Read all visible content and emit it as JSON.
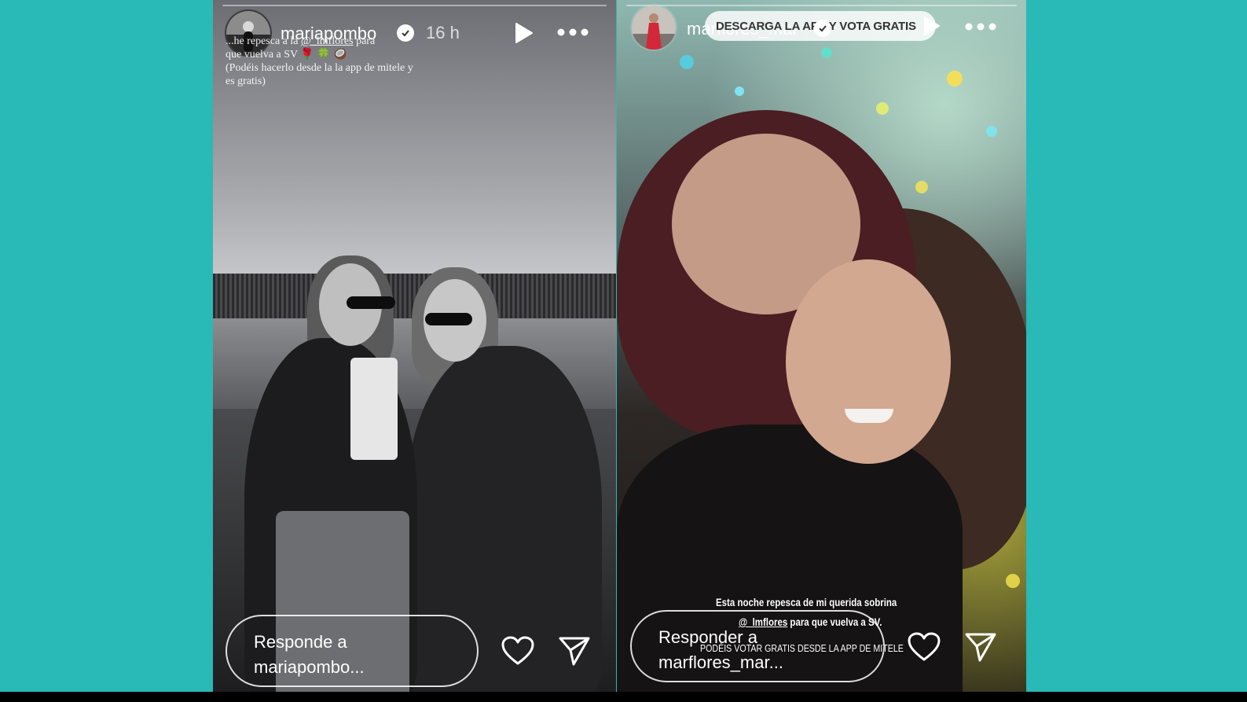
{
  "stories": {
    "left": {
      "username": "mariapombo",
      "timestamp": "16 h",
      "caption": {
        "line1_prefix": "...he repesca a la",
        "mention": "@_lmflores",
        "line1_suffix": "para",
        "line2": "que vuelva a SV 🌹 🍀 🥥",
        "line3": "(Podéis hacerlo desde la la app de mitele y",
        "line4": "es gratis)"
      },
      "reply_placeholder": {
        "line1": "Responde a",
        "line2": "mariapombo..."
      }
    },
    "right": {
      "username": "marflores_mar",
      "banner_text": "DESCARGA LA APP Y VOTA GRATIS",
      "caption": {
        "line1": "Esta noche repesca de mi querida sobrina",
        "mention": "@_lmflores",
        "line2_suffix": "para que vuelva a SV.",
        "line3": "PODÉIS VOTAR GRATIS DESDE LA APP DE MITELE"
      },
      "reply_placeholder": {
        "line1": "Responder a",
        "line2": "marflores_mar..."
      }
    }
  },
  "icons": {
    "verified": "verified-badge-icon",
    "play": "play-icon",
    "more": "more-options-icon",
    "like": "heart-icon",
    "share": "send-icon"
  },
  "colors": {
    "page_background": "#29b9b6",
    "overlay_text": "#ffffff"
  }
}
